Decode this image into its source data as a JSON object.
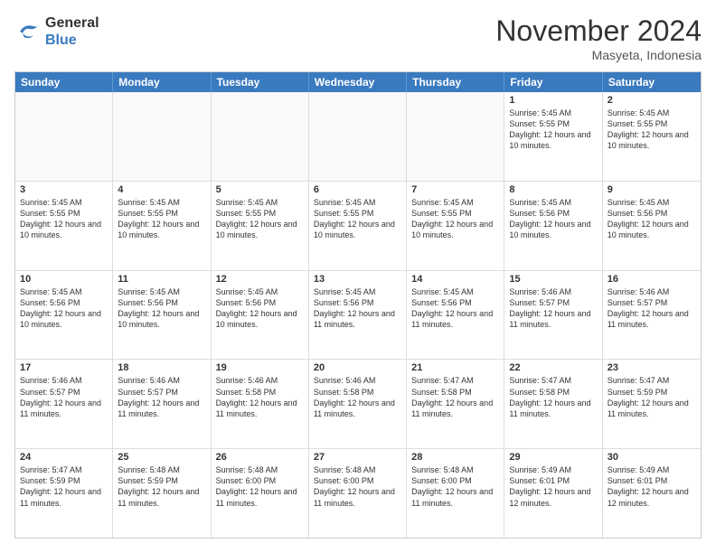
{
  "logo": {
    "line1": "General",
    "line2": "Blue"
  },
  "title": "November 2024",
  "location": "Masyeta, Indonesia",
  "days_of_week": [
    "Sunday",
    "Monday",
    "Tuesday",
    "Wednesday",
    "Thursday",
    "Friday",
    "Saturday"
  ],
  "rows": [
    [
      {
        "day": "",
        "empty": true
      },
      {
        "day": "",
        "empty": true
      },
      {
        "day": "",
        "empty": true
      },
      {
        "day": "",
        "empty": true
      },
      {
        "day": "",
        "empty": true
      },
      {
        "day": "1",
        "sunrise": "Sunrise: 5:45 AM",
        "sunset": "Sunset: 5:55 PM",
        "daylight": "Daylight: 12 hours and 10 minutes."
      },
      {
        "day": "2",
        "sunrise": "Sunrise: 5:45 AM",
        "sunset": "Sunset: 5:55 PM",
        "daylight": "Daylight: 12 hours and 10 minutes."
      }
    ],
    [
      {
        "day": "3",
        "sunrise": "Sunrise: 5:45 AM",
        "sunset": "Sunset: 5:55 PM",
        "daylight": "Daylight: 12 hours and 10 minutes."
      },
      {
        "day": "4",
        "sunrise": "Sunrise: 5:45 AM",
        "sunset": "Sunset: 5:55 PM",
        "daylight": "Daylight: 12 hours and 10 minutes."
      },
      {
        "day": "5",
        "sunrise": "Sunrise: 5:45 AM",
        "sunset": "Sunset: 5:55 PM",
        "daylight": "Daylight: 12 hours and 10 minutes."
      },
      {
        "day": "6",
        "sunrise": "Sunrise: 5:45 AM",
        "sunset": "Sunset: 5:55 PM",
        "daylight": "Daylight: 12 hours and 10 minutes."
      },
      {
        "day": "7",
        "sunrise": "Sunrise: 5:45 AM",
        "sunset": "Sunset: 5:55 PM",
        "daylight": "Daylight: 12 hours and 10 minutes."
      },
      {
        "day": "8",
        "sunrise": "Sunrise: 5:45 AM",
        "sunset": "Sunset: 5:56 PM",
        "daylight": "Daylight: 12 hours and 10 minutes."
      },
      {
        "day": "9",
        "sunrise": "Sunrise: 5:45 AM",
        "sunset": "Sunset: 5:56 PM",
        "daylight": "Daylight: 12 hours and 10 minutes."
      }
    ],
    [
      {
        "day": "10",
        "sunrise": "Sunrise: 5:45 AM",
        "sunset": "Sunset: 5:56 PM",
        "daylight": "Daylight: 12 hours and 10 minutes."
      },
      {
        "day": "11",
        "sunrise": "Sunrise: 5:45 AM",
        "sunset": "Sunset: 5:56 PM",
        "daylight": "Daylight: 12 hours and 10 minutes."
      },
      {
        "day": "12",
        "sunrise": "Sunrise: 5:45 AM",
        "sunset": "Sunset: 5:56 PM",
        "daylight": "Daylight: 12 hours and 10 minutes."
      },
      {
        "day": "13",
        "sunrise": "Sunrise: 5:45 AM",
        "sunset": "Sunset: 5:56 PM",
        "daylight": "Daylight: 12 hours and 11 minutes."
      },
      {
        "day": "14",
        "sunrise": "Sunrise: 5:45 AM",
        "sunset": "Sunset: 5:56 PM",
        "daylight": "Daylight: 12 hours and 11 minutes."
      },
      {
        "day": "15",
        "sunrise": "Sunrise: 5:46 AM",
        "sunset": "Sunset: 5:57 PM",
        "daylight": "Daylight: 12 hours and 11 minutes."
      },
      {
        "day": "16",
        "sunrise": "Sunrise: 5:46 AM",
        "sunset": "Sunset: 5:57 PM",
        "daylight": "Daylight: 12 hours and 11 minutes."
      }
    ],
    [
      {
        "day": "17",
        "sunrise": "Sunrise: 5:46 AM",
        "sunset": "Sunset: 5:57 PM",
        "daylight": "Daylight: 12 hours and 11 minutes."
      },
      {
        "day": "18",
        "sunrise": "Sunrise: 5:46 AM",
        "sunset": "Sunset: 5:57 PM",
        "daylight": "Daylight: 12 hours and 11 minutes."
      },
      {
        "day": "19",
        "sunrise": "Sunrise: 5:46 AM",
        "sunset": "Sunset: 5:58 PM",
        "daylight": "Daylight: 12 hours and 11 minutes."
      },
      {
        "day": "20",
        "sunrise": "Sunrise: 5:46 AM",
        "sunset": "Sunset: 5:58 PM",
        "daylight": "Daylight: 12 hours and 11 minutes."
      },
      {
        "day": "21",
        "sunrise": "Sunrise: 5:47 AM",
        "sunset": "Sunset: 5:58 PM",
        "daylight": "Daylight: 12 hours and 11 minutes."
      },
      {
        "day": "22",
        "sunrise": "Sunrise: 5:47 AM",
        "sunset": "Sunset: 5:58 PM",
        "daylight": "Daylight: 12 hours and 11 minutes."
      },
      {
        "day": "23",
        "sunrise": "Sunrise: 5:47 AM",
        "sunset": "Sunset: 5:59 PM",
        "daylight": "Daylight: 12 hours and 11 minutes."
      }
    ],
    [
      {
        "day": "24",
        "sunrise": "Sunrise: 5:47 AM",
        "sunset": "Sunset: 5:59 PM",
        "daylight": "Daylight: 12 hours and 11 minutes."
      },
      {
        "day": "25",
        "sunrise": "Sunrise: 5:48 AM",
        "sunset": "Sunset: 5:59 PM",
        "daylight": "Daylight: 12 hours and 11 minutes."
      },
      {
        "day": "26",
        "sunrise": "Sunrise: 5:48 AM",
        "sunset": "Sunset: 6:00 PM",
        "daylight": "Daylight: 12 hours and 11 minutes."
      },
      {
        "day": "27",
        "sunrise": "Sunrise: 5:48 AM",
        "sunset": "Sunset: 6:00 PM",
        "daylight": "Daylight: 12 hours and 11 minutes."
      },
      {
        "day": "28",
        "sunrise": "Sunrise: 5:48 AM",
        "sunset": "Sunset: 6:00 PM",
        "daylight": "Daylight: 12 hours and 11 minutes."
      },
      {
        "day": "29",
        "sunrise": "Sunrise: 5:49 AM",
        "sunset": "Sunset: 6:01 PM",
        "daylight": "Daylight: 12 hours and 12 minutes."
      },
      {
        "day": "30",
        "sunrise": "Sunrise: 5:49 AM",
        "sunset": "Sunset: 6:01 PM",
        "daylight": "Daylight: 12 hours and 12 minutes."
      }
    ]
  ]
}
